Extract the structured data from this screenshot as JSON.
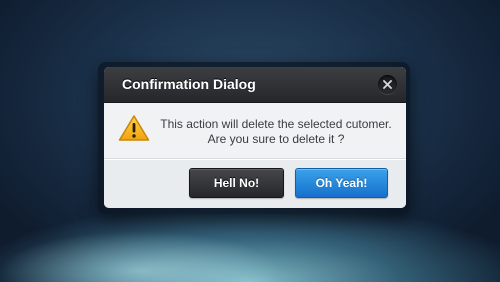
{
  "dialog": {
    "title": "Confirmation Dialog",
    "close_icon": "close-icon",
    "warning_icon": "warning-icon",
    "message_line1": "This action will delete the selected cutomer.",
    "message_line2": "Are you sure to delete it ?",
    "cancel_label": "Hell No!",
    "confirm_label": "Oh Yeah!"
  },
  "colors": {
    "header": "#2f3034",
    "body": "#f0f2f4",
    "cancel_button": "#35373b",
    "confirm_button": "#1f84db",
    "warning": "#f4b51c"
  }
}
